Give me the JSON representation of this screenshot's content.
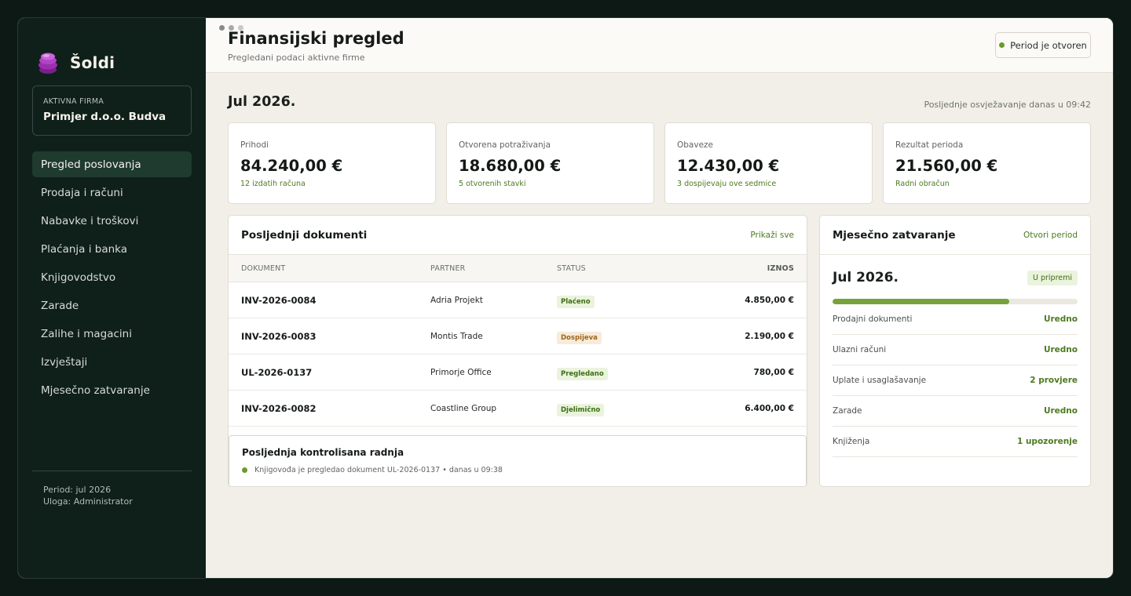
{
  "app": {
    "name": "Šoldi"
  },
  "window_dot_colors": [
    "#8a8a8a",
    "#a9a9a9",
    "#c8c8c8"
  ],
  "firm": {
    "label": "AKTIVNA FIRMA",
    "name": "Primjer d.o.o. Budva"
  },
  "sidebar": {
    "items": [
      {
        "label": "Pregled poslovanja",
        "active": true
      },
      {
        "label": "Prodaja i računi"
      },
      {
        "label": "Nabavke i troškovi"
      },
      {
        "label": "Plaćanja i banka"
      },
      {
        "label": "Knjigovodstvo"
      },
      {
        "label": "Zarade"
      },
      {
        "label": "Zalihe i magacini"
      },
      {
        "label": "Izvještaji"
      },
      {
        "label": "Mjesečno zatvaranje"
      }
    ],
    "footer": {
      "period": "Period: jul 2026",
      "role": "Uloga: Administrator"
    }
  },
  "header": {
    "title": "Finansijski pregled",
    "subtitle": "Pregledani podaci aktivne firme",
    "period_status": "Period je otvoren"
  },
  "overview": {
    "month": "Jul 2026.",
    "refresh": "Posljednje osvježavanje danas u 09:42"
  },
  "kpis": [
    {
      "label": "Prihodi",
      "value": "84.240,00 €",
      "note": "12 izdatih računa"
    },
    {
      "label": "Otvorena potraživanja",
      "value": "18.680,00 €",
      "note": "5 otvorenih stavki"
    },
    {
      "label": "Obaveze",
      "value": "12.430,00 €",
      "note": "3 dospijevaju ove sedmice"
    },
    {
      "label": "Rezultat perioda",
      "value": "21.560,00 €",
      "note": "Radni obračun"
    }
  ],
  "documents": {
    "title": "Posljednji dokumenti",
    "link": "Prikaži sve",
    "columns": [
      "DOKUMENT",
      "PARTNER",
      "STATUS",
      "IZNOS"
    ],
    "rows": [
      {
        "id": "INV-2026-0084",
        "partner": "Adria Projekt",
        "status": "Plaćeno",
        "tone": "green",
        "amount": "4.850,00 €"
      },
      {
        "id": "INV-2026-0083",
        "partner": "Montis Trade",
        "status": "Dospijeva",
        "tone": "amber",
        "amount": "2.190,00 €"
      },
      {
        "id": "UL-2026-0137",
        "partner": "Primorje Office",
        "status": "Pregledano",
        "tone": "green",
        "amount": "780,00 €"
      },
      {
        "id": "INV-2026-0082",
        "partner": "Coastline Group",
        "status": "Djelimično",
        "tone": "green",
        "amount": "6.400,00 €"
      }
    ]
  },
  "last_action": {
    "title": "Posljednja kontrolisana radnja",
    "text": "Knjigovođa je pregledao dokument UL-2026-0137 • danas u 09:38"
  },
  "closing": {
    "title": "Mjesečno zatvaranje",
    "link": "Otvori period",
    "month": "Jul 2026.",
    "badge": "U pripremi",
    "progress": 0.72,
    "checks": [
      {
        "label": "Prodajni dokumenti",
        "status": "Uredno"
      },
      {
        "label": "Ulazni računi",
        "status": "Uredno"
      },
      {
        "label": "Uplate i usaglašavanje",
        "status": "2 provjere"
      },
      {
        "label": "Zarade",
        "status": "Uredno"
      },
      {
        "label": "Knjiženja",
        "status": "1 upozorenje"
      }
    ]
  },
  "colors": {
    "accent": "#4d7a20",
    "sidebar": "#0f1f19",
    "progress": "#77a23b"
  }
}
